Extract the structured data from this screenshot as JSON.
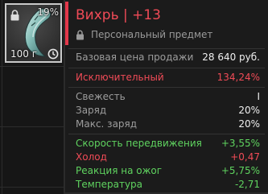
{
  "slot": {
    "charge_percent": "19%",
    "weight": "100 г",
    "item_icon": "artifact-claw-icon",
    "lock_icon": "lock-icon",
    "timer_icon": "clock-icon"
  },
  "tooltip": {
    "title": "Вихрь | +13",
    "subtitle": "Персональный предмет",
    "price_label": "Базовая цена продажи",
    "price_value": "28 640 руб.",
    "rarity_label": "Исключительный",
    "rarity_value": "134,24%",
    "freshness_label": "Свежесть",
    "freshness_value": "I",
    "charge_label": "Заряд",
    "charge_value": "20%",
    "max_charge_label": "Макс. заряд",
    "max_charge_value": "20%",
    "stats": [
      {
        "label": "Скорость передвижения",
        "value": "+3,55%",
        "color": "#5fd35f"
      },
      {
        "label": "Холод",
        "value": "+0,47",
        "color": "#f04b57"
      },
      {
        "label": "Реакция на ожог",
        "value": "+5,75%",
        "color": "#5fd35f"
      },
      {
        "label": "Температура",
        "value": "-2,71",
        "color": "#5fd35f"
      }
    ]
  },
  "colors": {
    "accent_red": "#e3384a",
    "positive_green": "#5fd35f",
    "slot_border": "#c9c9c9"
  }
}
